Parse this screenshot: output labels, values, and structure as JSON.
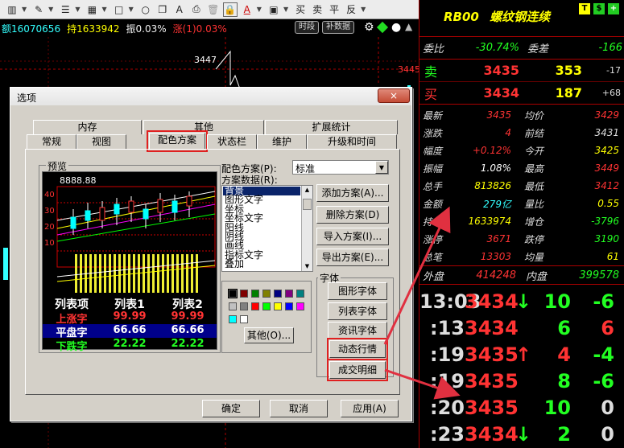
{
  "toolbar": {
    "icons": [
      "table-icon",
      "pencil-icon",
      "list-icon",
      "grid-icon",
      "square-icon",
      "circle-icon",
      "copy-icon",
      "font-icon",
      "print-icon",
      "trash-icon",
      "lock-icon",
      "text-color-icon",
      "save-icon"
    ],
    "buy": "买",
    "sell": "卖",
    "flat": "平",
    "reverse": "反"
  },
  "status": {
    "seg1": "额16070656",
    "seg2": "持1633942",
    "seg3": "振0.03%",
    "seg4": "涨(1)0.03%",
    "btn_timeshare": "时段",
    "btn_supplement": "补数据"
  },
  "chart_labels": {
    "v3447": "3447",
    "v3445": "3445"
  },
  "right": {
    "code": "RB00",
    "name": "螺纹钢连续",
    "badge_t": "T",
    "badge_s": "$",
    "badge_plus": "+",
    "ratio_label": "委比",
    "ratio": "-30.74%",
    "diff_label": "委差",
    "diff": "-166",
    "sell_label": "卖",
    "sell_price": "3435",
    "sell_vol": "353",
    "sell_chg": "-17",
    "buy_label": "买",
    "buy_price": "3434",
    "buy_vol": "187",
    "buy_chg": "+68",
    "stats": [
      [
        "最新",
        "3435",
        "均价",
        "3429"
      ],
      [
        "涨跌",
        "4",
        "前结",
        "3431"
      ],
      [
        "幅度",
        "+0.12%",
        "今开",
        "3425"
      ],
      [
        "振幅",
        "1.08%",
        "最高",
        "3449"
      ],
      [
        "总手",
        "813826",
        "最低",
        "3412"
      ],
      [
        "金额",
        "279亿",
        "量比",
        "0.55"
      ],
      [
        "持仓",
        "1633974",
        "增仓",
        "-3796"
      ],
      [
        "涨停",
        "3671",
        "跌停",
        "3190"
      ],
      [
        "总笔",
        "13303",
        "均量",
        "61"
      ]
    ],
    "outer_label": "外盘",
    "outer": "414248",
    "inner_label": "内盘",
    "inner": "399578",
    "ticks": [
      {
        "t": "13:03",
        "p": "3434",
        "d": "↓",
        "v": "10",
        "c": "-6"
      },
      {
        "t": ":13",
        "p": "3434",
        "d": "",
        "v": "6",
        "c": "6"
      },
      {
        "t": ":19",
        "p": "3435",
        "d": "↑",
        "v": "4",
        "c": "-4"
      },
      {
        "t": ":19",
        "p": "3435",
        "d": "",
        "v": "8",
        "c": "-6"
      },
      {
        "t": ":20",
        "p": "3435",
        "d": "",
        "v": "10",
        "c": "0"
      },
      {
        "t": ":23",
        "p": "3434",
        "d": "↓",
        "v": "2",
        "c": "0"
      }
    ]
  },
  "dialog": {
    "title": "选项",
    "close": "×",
    "tabs_back": [
      "内存",
      "其他",
      "扩展统计"
    ],
    "tabs_front": [
      "常规",
      "视图",
      "配色方案",
      "状态栏",
      "维护",
      "升级和时间"
    ],
    "preview_label": "预览",
    "preview_value": "8888.88",
    "axis": [
      "40",
      "30",
      "20",
      "10"
    ],
    "list_headers": [
      "列表项",
      "列表1",
      "列表2"
    ],
    "list_rows": [
      [
        "上涨字",
        "99.99",
        "99.99"
      ],
      [
        "平盘字",
        "66.66",
        "66.66"
      ],
      [
        "下跌字",
        "22.22",
        "22.22"
      ]
    ],
    "scheme_label": "配色方案(P):",
    "scheme_value": "标准",
    "data_label": "方案数据(R):",
    "scheme_items": [
      "背景",
      "图形文字",
      "坐标",
      "坐标文字",
      "阳线",
      "阴线",
      "画线",
      "指标文字",
      "叠加"
    ],
    "btn_add": "添加方案(A)...",
    "btn_del": "删除方案(D)",
    "btn_import": "导入方案(I)...",
    "btn_export": "导出方案(E)...",
    "font_label": "字体",
    "btn_chart_font": "图形字体",
    "btn_list_font": "列表字体",
    "btn_info_font": "资讯字体",
    "btn_dynamic": "动态行情",
    "btn_deal": "成交明细",
    "btn_other": "其他(O)...",
    "btn_ok": "确定",
    "btn_cancel": "取消",
    "btn_apply": "应用(A)"
  },
  "colors": {
    "up": "#ff3030",
    "down": "#20ff20",
    "neutral": "#ffffff",
    "accent": "#e02020"
  }
}
